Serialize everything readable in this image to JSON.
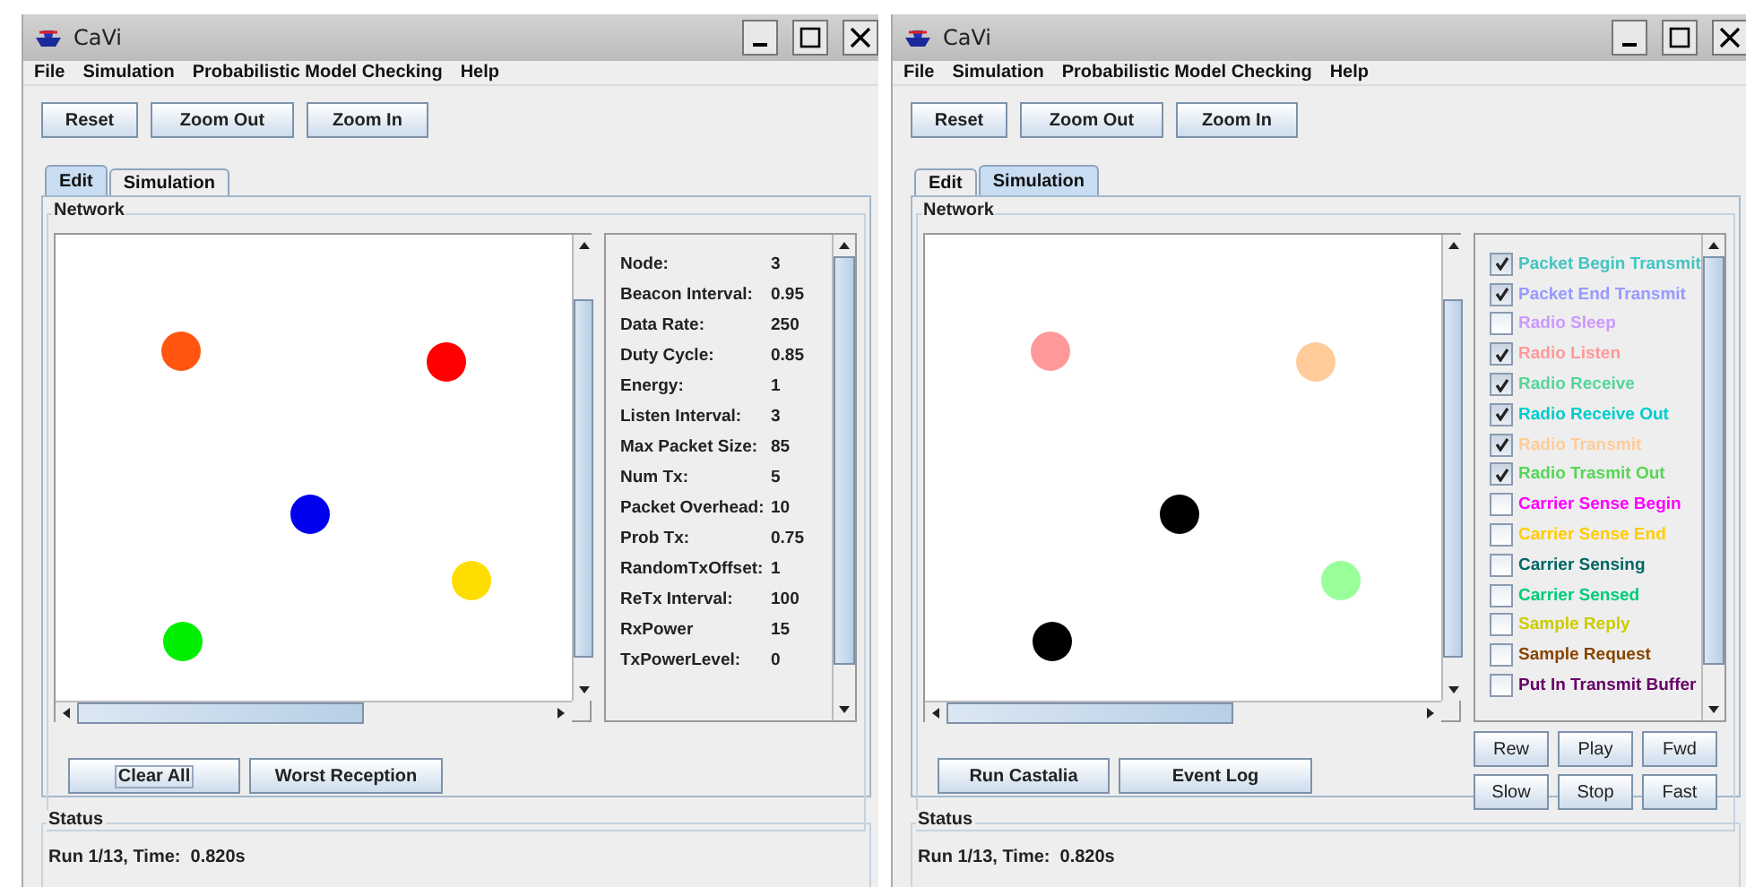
{
  "windows": [
    {
      "title": "CaVi",
      "menu": [
        "File",
        "Simulation",
        "Probabilistic Model Checking",
        "Help"
      ],
      "toolbar": [
        "Reset",
        "Zoom Out",
        "Zoom In"
      ],
      "tabs": [
        {
          "label": "Edit",
          "selected": true
        },
        {
          "label": "Simulation",
          "selected": false
        }
      ],
      "network": {
        "label": "Network",
        "nodes": [
          {
            "color": "#ff5511"
          },
          {
            "color": "#ff0000"
          },
          {
            "color": "#0000ee"
          },
          {
            "color": "#ffdd00"
          },
          {
            "color": "#00ee00"
          }
        ],
        "side_panel": {
          "kind": "properties",
          "rows": [
            {
              "label": "Node:",
              "value": "3"
            },
            {
              "label": "Beacon Interval:",
              "value": "0.95"
            },
            {
              "label": "Data Rate:",
              "value": "250"
            },
            {
              "label": "Duty Cycle:",
              "value": "0.85"
            },
            {
              "label": "Energy:",
              "value": "1"
            },
            {
              "label": "Listen Interval:",
              "value": "3"
            },
            {
              "label": "Max Packet Size:",
              "value": "85"
            },
            {
              "label": "Num Tx:",
              "value": "5"
            },
            {
              "label": "Packet Overhead:",
              "value": "10"
            },
            {
              "label": "Prob Tx:",
              "value": "0.75"
            },
            {
              "label": "RandomTxOffset:",
              "value": "1"
            },
            {
              "label": "ReTx Interval:",
              "value": "100"
            },
            {
              "label": "RxPower",
              "value": "15"
            },
            {
              "label": "TxPowerLevel:",
              "value": "0"
            }
          ]
        },
        "actions": [
          {
            "label": "Clear All",
            "focused": true
          },
          {
            "label": "Worst Reception",
            "focused": false
          }
        ]
      },
      "status": {
        "label": "Status",
        "text": "Run 1/13, Time:  0.820s"
      }
    },
    {
      "title": "CaVi",
      "menu": [
        "File",
        "Simulation",
        "Probabilistic Model Checking",
        "Help"
      ],
      "toolbar": [
        "Reset",
        "Zoom Out",
        "Zoom In"
      ],
      "tabs": [
        {
          "label": "Edit",
          "selected": false
        },
        {
          "label": "Simulation",
          "selected": true
        }
      ],
      "network": {
        "label": "Network",
        "nodes": [
          {
            "color": "#ff9999"
          },
          {
            "color": "#ffcc99"
          },
          {
            "color": "#000000"
          },
          {
            "color": "#99ff99"
          },
          {
            "color": "#000000"
          }
        ],
        "side_panel": {
          "kind": "events",
          "items": [
            {
              "label": "Packet Begin Transmit",
              "checked": true,
              "color": "#44c4c4"
            },
            {
              "label": "Packet End Transmit",
              "checked": true,
              "color": "#9999ff"
            },
            {
              "label": "Radio Sleep",
              "checked": false,
              "color": "#cc99ff"
            },
            {
              "label": "Radio Listen",
              "checked": true,
              "color": "#ff9999"
            },
            {
              "label": "Radio Receive",
              "checked": true,
              "color": "#55d699"
            },
            {
              "label": "Radio Receive Out",
              "checked": true,
              "color": "#00cccc"
            },
            {
              "label": "Radio Transmit",
              "checked": true,
              "color": "#ffcc99"
            },
            {
              "label": "Radio Trasmit Out",
              "checked": true,
              "color": "#55d655"
            },
            {
              "label": "Carrier Sense Begin",
              "checked": false,
              "color": "#ff00ff"
            },
            {
              "label": "Carrier Sense End",
              "checked": false,
              "color": "#ffcc00"
            },
            {
              "label": "Carrier Sensing",
              "checked": false,
              "color": "#006666"
            },
            {
              "label": "Carrier Sensed",
              "checked": false,
              "color": "#00cc77"
            },
            {
              "label": "Sample Reply",
              "checked": false,
              "color": "#cccc00"
            },
            {
              "label": "Sample Request",
              "checked": false,
              "color": "#884400"
            },
            {
              "label": "Put In Transmit Buffer",
              "checked": false,
              "color": "#660066"
            }
          ]
        },
        "actions": [
          {
            "label": "Run Castalia",
            "focused": false
          },
          {
            "label": "Event Log",
            "focused": false
          }
        ],
        "playback": [
          "Rew",
          "Play",
          "Fwd",
          "Slow",
          "Stop",
          "Fast"
        ]
      },
      "status": {
        "label": "Status",
        "text": "Run 1/13, Time:  0.820s"
      }
    }
  ]
}
